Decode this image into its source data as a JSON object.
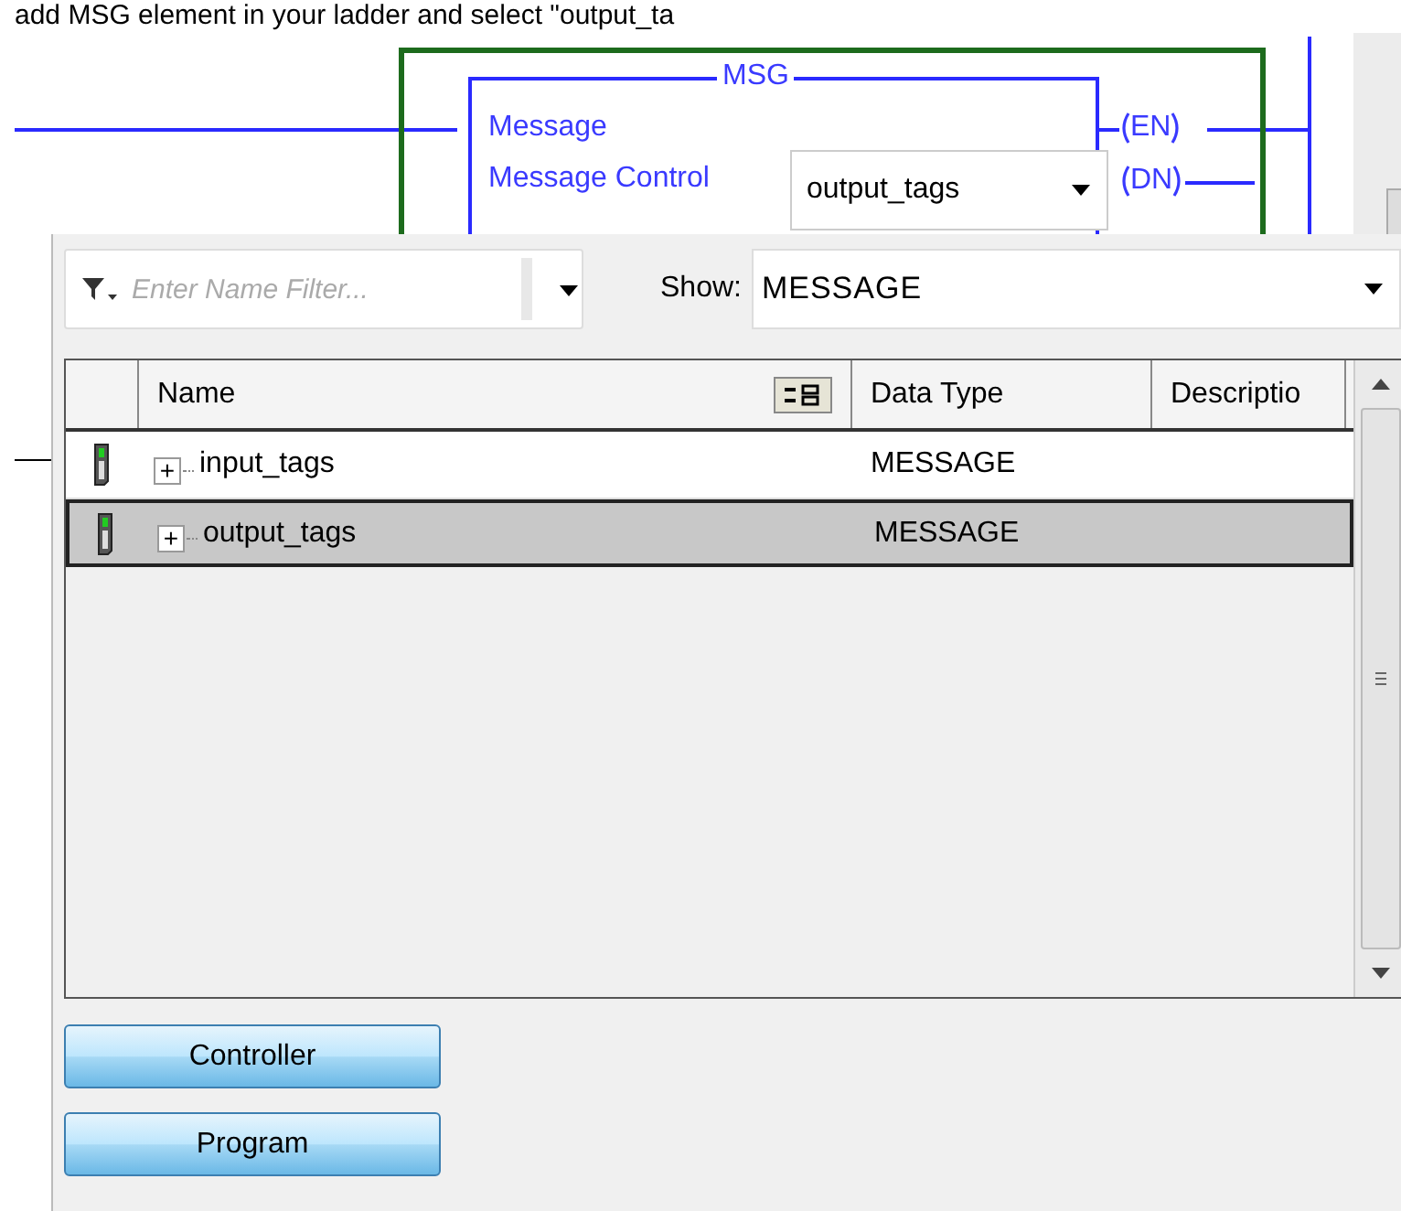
{
  "instruction_text": "add MSG element in your ladder and select \"output_ta",
  "ladder": {
    "title": "MSG",
    "operands": [
      {
        "label": "Message"
      },
      {
        "label": "Message Control",
        "value": "output_tags"
      }
    ],
    "outputs": [
      "EN",
      "DN"
    ]
  },
  "tag_browser": {
    "filter": {
      "placeholder": "Enter Name Filter..."
    },
    "show": {
      "label": "Show:",
      "value": "MESSAGE"
    },
    "columns": [
      "Name",
      "Data Type",
      "Descriptio"
    ],
    "rows": [
      {
        "expander": "+",
        "name": "input_tags",
        "data_type": "MESSAGE",
        "selected": false
      },
      {
        "expander": "+",
        "name": "output_tags",
        "data_type": "MESSAGE",
        "selected": true
      }
    ],
    "buttons": [
      "Controller",
      "Program"
    ]
  }
}
